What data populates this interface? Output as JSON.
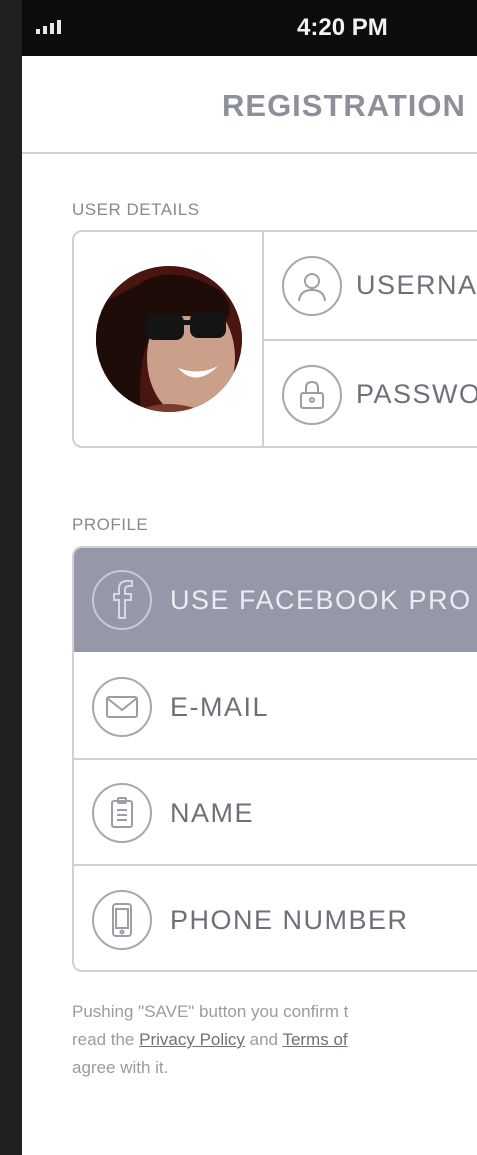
{
  "status_bar": {
    "time": "4:20 PM"
  },
  "nav": {
    "title": "REGISTRATION"
  },
  "user_details": {
    "section_label": "USER DETAILS",
    "username_placeholder": "USERNA",
    "password_placeholder": "PASSWO"
  },
  "profile": {
    "section_label": "PROFILE",
    "facebook_label": "USE FACEBOOK PRO",
    "email_label": "E-MAIL",
    "name_label": "NAME",
    "phone_label": "PHONE NUMBER"
  },
  "footer": {
    "line1": "Pushing \"SAVE\" button you confirm t",
    "line2_prefix": "read the ",
    "privacy_link": "Privacy Policy",
    "line2_mid": " and ",
    "terms_link": "Terms of",
    "line3": "agree with it."
  },
  "colors": {
    "facebook_row_bg": "#9598a9",
    "title_color": "#8d8f9a",
    "border": "#cfd0d3"
  },
  "icons": [
    "signal-icon",
    "user-icon",
    "lock-icon",
    "facebook-icon",
    "envelope-icon",
    "clipboard-icon",
    "phone-icon"
  ]
}
